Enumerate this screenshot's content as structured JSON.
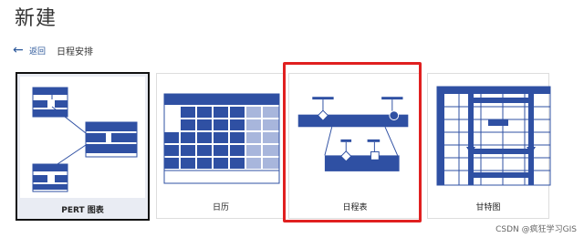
{
  "header": {
    "title": "新建"
  },
  "nav": {
    "back_label": "返回",
    "breadcrumb": "日程安排"
  },
  "cards": [
    {
      "label": "PERT 图表",
      "selected": true
    },
    {
      "label": "日历",
      "selected": false
    },
    {
      "label": "日程表",
      "selected": false,
      "highlighted": true
    },
    {
      "label": "甘特图",
      "selected": false
    }
  ],
  "watermark": "CSDN @疯狂学习GIS",
  "colors": {
    "accent": "#2b579a",
    "shape_fill": "#2f50a3",
    "highlight": "#e02020",
    "light_fill": "#a8b6dc"
  }
}
